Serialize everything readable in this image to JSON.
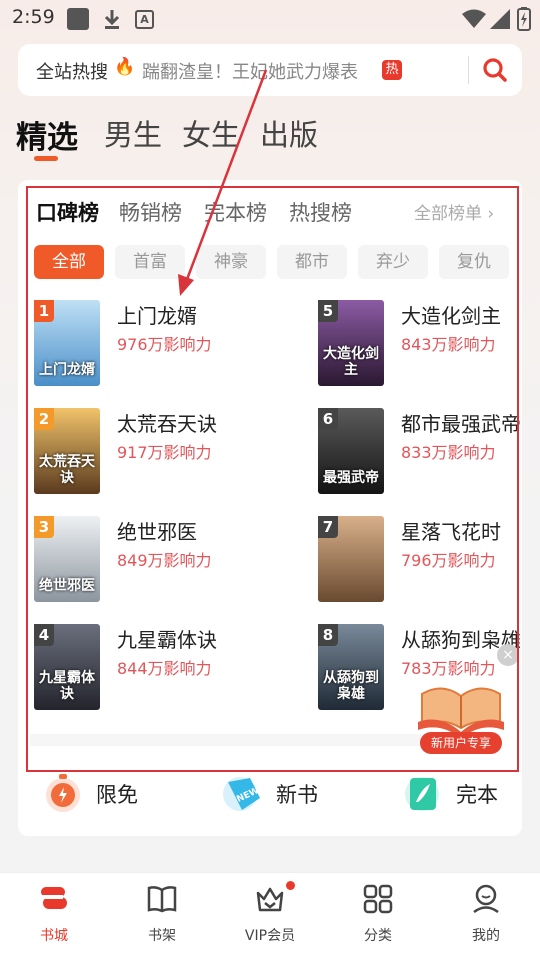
{
  "status_bar": {
    "time": "2:59",
    "a_icon": "A"
  },
  "search": {
    "label": "全站热搜",
    "fire": "🔥",
    "query": "踹翻渣皇！王妃她武力爆表",
    "hot_badge": "热"
  },
  "top_tabs": [
    "精选",
    "男生",
    "女生",
    "出版"
  ],
  "rank_tabs": [
    "口碑榜",
    "畅销榜",
    "完本榜",
    "热搜榜"
  ],
  "all_ranks": "全部榜单 ›",
  "chips": [
    "全部",
    "首富",
    "神豪",
    "都市",
    "弃少",
    "复仇"
  ],
  "books": [
    {
      "rank": "1",
      "title": "上门龙婿",
      "influence": "976万影响力",
      "cover_text": "上门龙婿",
      "cover_color": "#6aa8d8"
    },
    {
      "rank": "2",
      "title": "太荒吞天诀",
      "influence": "917万影响力",
      "cover_text": "太荒吞天诀",
      "cover_color": "#5a3a1e"
    },
    {
      "rank": "3",
      "title": "绝世邪医",
      "influence": "849万影响力",
      "cover_text": "绝世邪医",
      "cover_color": "#a9b3bd"
    },
    {
      "rank": "4",
      "title": "九星霸体诀",
      "influence": "844万影响力",
      "cover_text": "九星霸体诀",
      "cover_color": "#3b3d4a"
    },
    {
      "rank": "5",
      "title": "大造化剑主",
      "influence": "843万影响力",
      "cover_text": "大造化剑主",
      "cover_color": "#4a2a55"
    },
    {
      "rank": "6",
      "title": "都市最强武帝",
      "influence": "833万影响力",
      "cover_text": "最强武帝",
      "cover_color": "#2c2c2c"
    },
    {
      "rank": "7",
      "title": "星落飞花时",
      "influence": "796万影响力",
      "cover_text": "",
      "cover_color": "#8a6a4e"
    },
    {
      "rank": "8",
      "title": "从舔狗到枭雄",
      "influence": "783万影响力",
      "cover_text": "从舔狗到枭雄",
      "cover_color": "#3a4a5a"
    }
  ],
  "quick_links": [
    "限免",
    "新书",
    "完本"
  ],
  "promo": {
    "tag": "新用户专享",
    "close": "×"
  },
  "bottom_nav": [
    "书城",
    "书架",
    "VIP会员",
    "分类",
    "我的"
  ],
  "colors": {
    "accent": "#f05a28",
    "hot_red": "#e8392c",
    "influence": "#e2565a",
    "annotation": "#d9343b"
  }
}
